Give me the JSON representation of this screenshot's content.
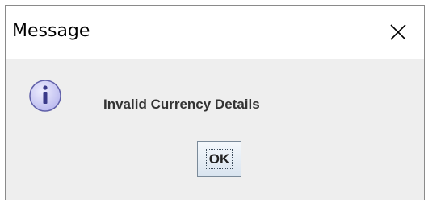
{
  "window": {
    "title": "Message"
  },
  "dialog": {
    "icon": "info-icon",
    "message": "Invalid Currency Details",
    "ok_label": "OK"
  },
  "colors": {
    "icon_fill": "#c9c8f4",
    "icon_stroke": "#5f5fa8",
    "button_border": "#7a8a99"
  }
}
